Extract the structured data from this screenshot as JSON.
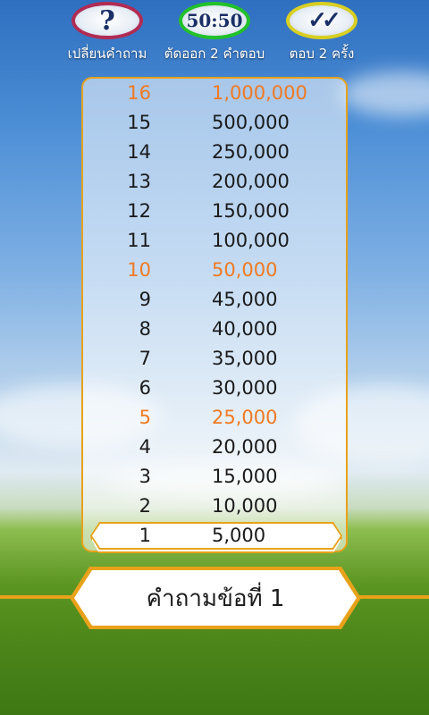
{
  "lifelines": [
    {
      "symbol": "?",
      "label": "เปลี่ยนคำถาม",
      "icon": "question-mark-icon",
      "color": "#b12c54"
    },
    {
      "symbol": "50:50",
      "label": "ตัดออก 2 คำตอบ",
      "icon": "fifty-fifty-icon",
      "color": "#22c12a"
    },
    {
      "symbol": "✓✓",
      "label": "ตอบ 2 ครั้ง",
      "icon": "double-check-icon",
      "color": "#d8cf22"
    }
  ],
  "ladder": [
    {
      "level": "16",
      "amount": "1,000,000"
    },
    {
      "level": "15",
      "amount": "500,000"
    },
    {
      "level": "14",
      "amount": "250,000"
    },
    {
      "level": "13",
      "amount": "200,000"
    },
    {
      "level": "12",
      "amount": "150,000"
    },
    {
      "level": "11",
      "amount": "100,000"
    },
    {
      "level": "10",
      "amount": "50,000"
    },
    {
      "level": "9",
      "amount": "45,000"
    },
    {
      "level": "8",
      "amount": "40,000"
    },
    {
      "level": "7",
      "amount": "35,000"
    },
    {
      "level": "6",
      "amount": "30,000"
    },
    {
      "level": "5",
      "amount": "25,000"
    },
    {
      "level": "4",
      "amount": "20,000"
    },
    {
      "level": "3",
      "amount": "15,000"
    },
    {
      "level": "2",
      "amount": "10,000"
    },
    {
      "level": "1",
      "amount": "5,000"
    }
  ],
  "milestone_levels": [
    "16",
    "10",
    "5"
  ],
  "current_level": "1",
  "colors": {
    "accent": "#e8a21a",
    "milestone": "#f07a22"
  },
  "question": {
    "label": "คำถามข้อที่ 1"
  }
}
